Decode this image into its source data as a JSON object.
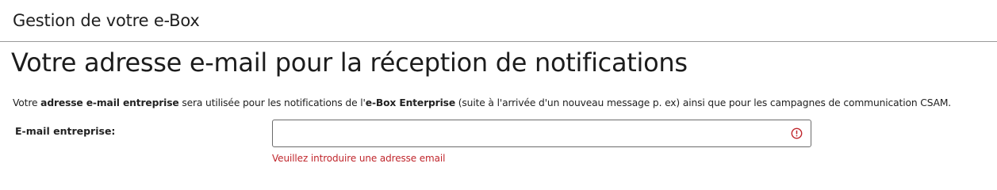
{
  "header": {
    "section_title": "Gestion de votre e-Box"
  },
  "main": {
    "title": "Votre adresse e-mail pour la réception de notifications",
    "description": {
      "part1": "Votre ",
      "bold1": "adresse e-mail entreprise",
      "part2": " sera utilisée pour les notifications de l'",
      "bold2": "e-Box Enterprise",
      "part3": " (suite à l'arrivée d'un nouveau message p. ex) ainsi que pour les campagnes de communication CSAM."
    },
    "email_field": {
      "label": "E-mail entreprise:",
      "value": "",
      "placeholder": "",
      "error_icon": "error-circle-icon",
      "error_message": "Veuillez introduire une adresse email"
    }
  },
  "colors": {
    "error": "#c0262c",
    "divider": "#9a9a9a",
    "input_border": "#6b6b6b"
  }
}
